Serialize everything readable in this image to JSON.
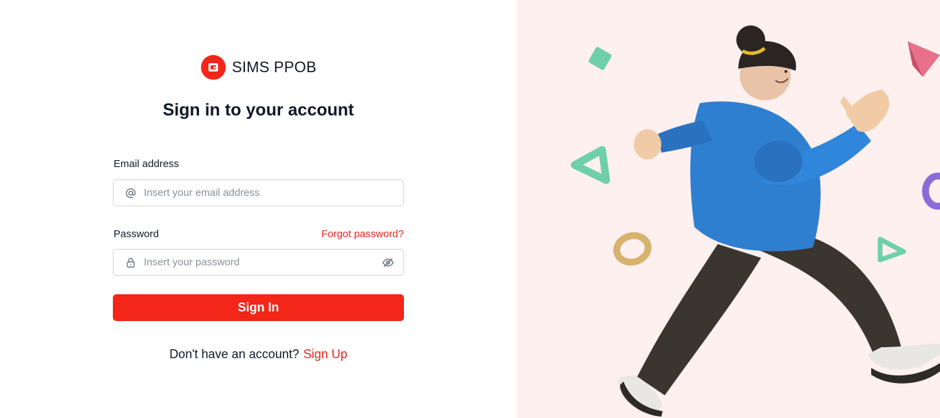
{
  "brand": {
    "name": "SIMS PPOB",
    "logo_icon": "wallet-icon",
    "color": "#f42619"
  },
  "heading": "Sign in to your account",
  "form": {
    "email_label": "Email address",
    "email_placeholder": "Insert your email address",
    "email_value": "",
    "email_icon": "at-sign-icon",
    "password_label": "Password",
    "password_placeholder": "Insert your password",
    "password_value": "",
    "password_icon": "lock-icon",
    "toggle_icon": "eye-off-icon",
    "forgot_label": "Forgot password?",
    "submit_label": "Sign In"
  },
  "signup": {
    "prompt": "Don't have an account?",
    "link_label": "Sign Up"
  },
  "colors": {
    "accent": "#f42619",
    "link": "#e5271d",
    "panel_bg": "#fdf0ef"
  },
  "illustration": {
    "description_icon": "walking-person-illustration"
  }
}
